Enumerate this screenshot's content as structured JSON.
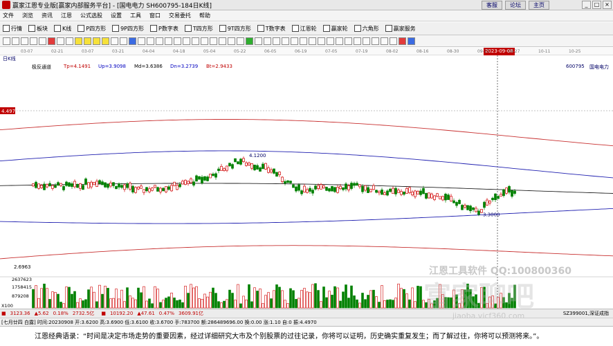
{
  "window": {
    "title": "赢家江恩专业版[赢家内部服务平台] - [国电电力  SH600795-184日K线]",
    "links": [
      "客服",
      "论坛",
      "主页"
    ],
    "controls": [
      "_",
      "□",
      "×"
    ]
  },
  "menu": [
    "文件",
    "浏览",
    "资讯",
    "江恩",
    "公式选股",
    "设置",
    "工具",
    "窗口",
    "交易委托",
    "帮助"
  ],
  "toolbar": [
    "行情",
    "板块",
    "K线",
    "P四方形",
    "9P四方形",
    "P数字表",
    "T四方形",
    "9T四方形",
    "T数字表",
    "江恩轮",
    "赢家轮",
    "六角形",
    "赢家服务"
  ],
  "date_axis": {
    "labels": [
      "03-07",
      "02-21",
      "03-07",
      "03-21",
      "04-04",
      "04-18",
      "05-04",
      "05-22",
      "06-05",
      "06-19",
      "07-05",
      "07-19",
      "08-02",
      "08-16",
      "08-30",
      "09-13",
      "09-27",
      "10-11",
      "10-25"
    ],
    "highlight": "2023-09-08"
  },
  "indicator": {
    "period_label": "日K线",
    "name": "极反通道",
    "tp": "Tp=4.1491",
    "up": "Up=3.9098",
    "md": "Md=3.6386",
    "dn": "Dn=3.2739",
    "bt": "Bt=2.9433",
    "stock": "600795",
    "stock_name": "国电电力"
  },
  "price_labels": {
    "tp_marker": "4.4970",
    "high_annot": "4.1200",
    "low_annot": "3.3000",
    "bottom_price": "2.6963"
  },
  "volume_axis": [
    "2637623",
    "1758415",
    "879208",
    "X100"
  ],
  "status": {
    "sh_index": "3123.36",
    "sh_change": "▲5.62",
    "sh_pct": "0.18%",
    "sh_amount": "2732.5亿",
    "sz_index": "10192.20",
    "sz_change": "▲47.61",
    "sz_pct": "0.47%",
    "sz_amount": "3609.91亿",
    "sz_code": "SZ399001,深证成指"
  },
  "bar_info": "[七月廿四 白露] 时间:20230908 开:3.6200 高:3.6900 低:3.6100 收:3.6700 手:783700 额:286489696.00 换:0.00 涨:1.10 自:0 振:4.4970",
  "footer_text": "江恩经典语录：“时间是决定市场走势的重要因素，经过详细研究大市及个别股票的过往记录，你将可以证明，历史确实重复发生；而了解过往，你将可以预测将来。”。",
  "watermark": {
    "line1": "江恩工具软件  QQ:100800360",
    "line2": "富家聊吧",
    "line3": "jiaoba.vicf360.com"
  },
  "chart_data": {
    "type": "candlestick",
    "ylim": [
      2.6963,
      4.497
    ],
    "channel": {
      "tp": 4.1491,
      "up": 3.9098,
      "md": 3.6386,
      "dn": 3.2739,
      "bt": 2.9433
    },
    "volume_ylim": [
      0,
      2637623
    ]
  }
}
